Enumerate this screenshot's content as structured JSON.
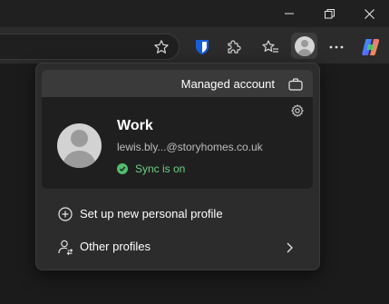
{
  "window_controls": {
    "minimize_icon": "minimize-icon",
    "restore_icon": "restore-icon",
    "close_icon": "close-icon"
  },
  "toolbar": {
    "icons": [
      "favorite-star-icon",
      "bitwarden-extension-icon",
      "extensions-puzzle-icon",
      "favorites-list-icon",
      "profile-avatar-icon",
      "more-menu-icon",
      "copilot-icon"
    ],
    "accent_bitwarden": "#175ddc"
  },
  "flyout": {
    "managed_label": "Managed account",
    "profile": {
      "name": "Work",
      "email": "lewis.bly...@storyhomes.co.uk",
      "sync_status": "Sync is on",
      "sync_color": "#6ccf84"
    },
    "menu": [
      {
        "label": "Set up new personal profile",
        "icon": "add-circle-icon"
      },
      {
        "label": "Other profiles",
        "icon": "switch-profile-icon"
      }
    ]
  }
}
